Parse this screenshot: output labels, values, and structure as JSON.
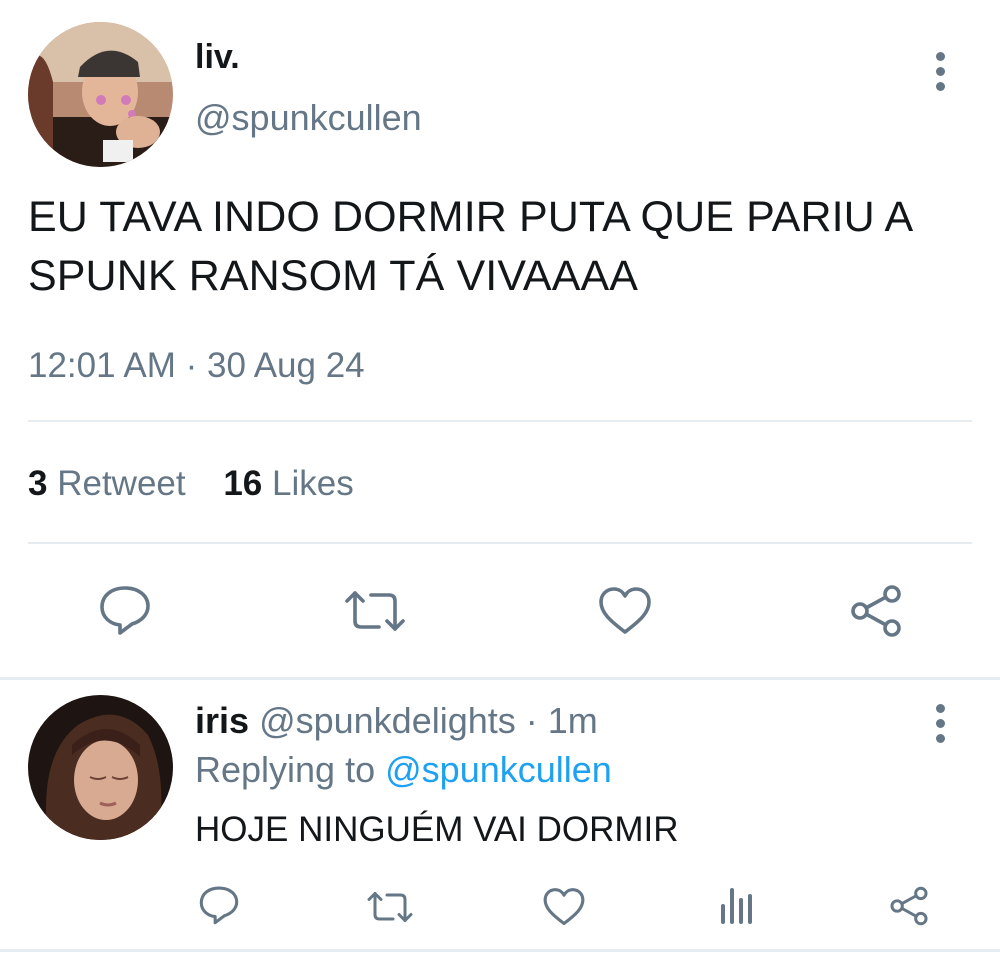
{
  "tweet": {
    "display_name": "liv.",
    "handle": "@spunkcullen",
    "text_line1": "EU TAVA INDO DORMIR PUTA QUE PARIU A",
    "text_line2": "SPUNK RANSOM TÁ VIVAAAA",
    "timestamp": "12:01 AM · 30 Aug 24",
    "retweet_count": "3",
    "retweet_label": "Retweet",
    "like_count": "16",
    "like_label": "Likes"
  },
  "reply": {
    "display_name": "iris",
    "handle": "@spunkdelights",
    "time": "· 1m",
    "replying_prefix": "Replying to",
    "replying_to": "@spunkcullen",
    "text": "HOJE NINGUÉM VAI DORMIR"
  },
  "icons": {
    "reply": "reply-icon",
    "retweet": "retweet-icon",
    "like": "heart-icon",
    "share": "share-icon",
    "analytics": "analytics-icon",
    "more": "more-icon"
  },
  "colors": {
    "text": "#14171a",
    "muted": "#657786",
    "link": "#1da1f2",
    "divider": "#e6ecf0",
    "background": "#ffffff"
  }
}
